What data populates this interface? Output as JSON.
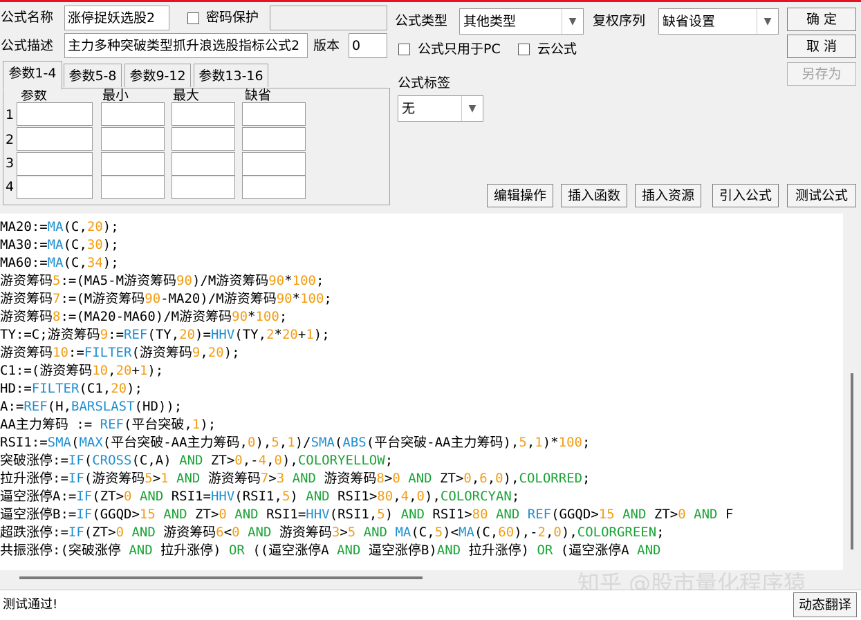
{
  "header": {
    "name_label": "公式名称",
    "name_value": "涨停捉妖选股2",
    "password_label": "密码保护",
    "password_value": "",
    "desc_label": "公式描述",
    "desc_value": "主力多种突破类型抓升浪选股指标公式2",
    "version_label": "版本",
    "version_value": "0",
    "type_label": "公式类型",
    "type_value": "其他类型",
    "rights_label": "复权序列",
    "rights_value": "缺省设置",
    "pc_only_label": "公式只用于PC",
    "cloud_label": "云公式",
    "tag_label": "公式标签",
    "tag_value": "无"
  },
  "buttons": {
    "ok": "确  定",
    "cancel": "取  消",
    "save_as": "另存为"
  },
  "tabs": [
    "参数1-4",
    "参数5-8",
    "参数9-12",
    "参数13-16"
  ],
  "params": {
    "headers": [
      "参数",
      "最小",
      "最大",
      "缺省"
    ],
    "rows": [
      "1",
      "2",
      "3",
      "4"
    ]
  },
  "toolbar": [
    "编辑操作",
    "插入函数",
    "插入资源",
    "引入公式",
    "测试公式"
  ],
  "code": [
    "MA20:=MA(C,20);",
    "MA30:=MA(C,30);",
    "MA60:=MA(C,34);",
    "游资筹码5:=(MA5-M游资筹码90)/M游资筹码90*100;",
    "游资筹码7:=(M游资筹码90-MA20)/M游资筹码90*100;",
    "游资筹码8:=(MA20-MA60)/M游资筹码90*100;",
    "TY:=C;游资筹码9:=REF(TY,20)=HHV(TY,2*20+1);",
    "游资筹码10:=FILTER(游资筹码9,20);",
    "C1:=(游资筹码10,20+1);",
    "HD:=FILTER(C1,20);",
    "A:=REF(H,BARSLAST(HD));",
    "AA主力筹码 := REF(平台突破,1);",
    "RSI1:=SMA(MAX(平台突破-AA主力筹码,0),5,1)/SMA(ABS(平台突破-AA主力筹码),5,1)*100;",
    "突破涨停:=IF(CROSS(C,A) AND ZT>0,-4,0),COLORYELLOW;",
    "拉升涨停:=IF(游资筹码5>1 AND 游资筹码7>3 AND 游资筹码8>0 AND ZT>0,6,0),COLORRED;",
    "逼空涨停A:=IF(ZT>0 AND RSI1=HHV(RSI1,5) AND RSI1>80,4,0),COLORCYAN;",
    "逼空涨停B:=IF(GGQD>15 AND ZT>0 AND RSI1=HHV(RSI1,5) AND RSI1>80 AND REF(GGQD>15 AND ZT>0 AND F",
    "超跌涨停:=IF(ZT>0 AND 游资筹码6<0 AND 游资筹码3>5 AND MA(C,5)<MA(C,60),-2,0),COLORGREEN;",
    "共振涨停:(突破涨停 AND 拉升涨停) OR ((逼空涨停A AND 逼空涨停B)AND 拉升涨停) OR (逼空涨停A AND"
  ],
  "highlight": {
    "functions": [
      "MA",
      "REF",
      "HHV",
      "FILTER",
      "BARSLAST",
      "SMA",
      "MAX",
      "ABS",
      "IF",
      "CROSS"
    ],
    "keywords": [
      "AND",
      "OR",
      "COLORYELLOW",
      "COLORRED",
      "COLORCYAN",
      "COLORGREEN"
    ],
    "function_color": "#1f8fd1",
    "number_color": "#f39d12",
    "keyword_color": "#1aa336"
  },
  "status": {
    "message": "测试通过!",
    "translate_button": "动态翻译"
  },
  "watermark": "知乎 @股市量化程序猿"
}
